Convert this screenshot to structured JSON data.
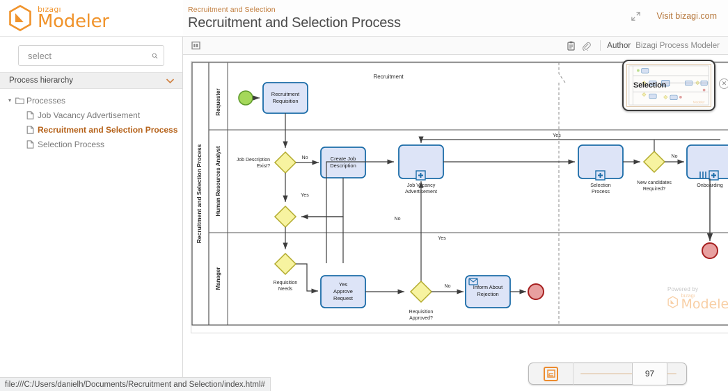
{
  "brand": {
    "small": "bızagı",
    "name": "Modeler",
    "accent": "#f0932b"
  },
  "header": {
    "breadcrumb": "Recruitment and Selection",
    "title": "Recruitment and Selection Process",
    "fullscreen_icon": "fullscreen-icon",
    "visit_link": "Visit bizagi.com"
  },
  "toolbar": {
    "panel_icon": "panel-toggle-icon",
    "doc_icon": "document-icon",
    "attach_icon": "paperclip-icon",
    "author_label": "Author",
    "author_value": "Bizagi Process Modeler"
  },
  "sidebar": {
    "search": {
      "placeholder": "select",
      "value": "",
      "icon": "search-icon"
    },
    "hierarchy_header": {
      "label": "Process hierarchy",
      "chevron": "chevron-down-icon"
    },
    "tree": [
      {
        "label": "Processes",
        "level": 1,
        "icon": "folder-icon",
        "caret": "▾",
        "active": false
      },
      {
        "label": "Job Vacancy Advertisement",
        "level": 2,
        "icon": "file-icon",
        "active": false
      },
      {
        "label": "Recruitment and Selection Process",
        "level": 2,
        "icon": "file-icon",
        "active": true
      },
      {
        "label": "Selection Process",
        "level": 2,
        "icon": "file-icon",
        "active": false
      }
    ]
  },
  "diagram": {
    "pool_label": "Recruitment and Selection Process",
    "phase_label": "Recruitment",
    "lanes": [
      "Requester",
      "Human Resources Analyst",
      "Manager"
    ],
    "nodes": {
      "start_event": "start-event",
      "recruitment_requisition": "Recruitment\nRequisition",
      "recruitment_requisition_l1": "Recruitment",
      "recruitment_requisition_l2": "Requisition",
      "job_desc_gw_l1": "Job Description",
      "job_desc_gw_l2": "Exist?",
      "create_job_desc_l1": "Create Job",
      "create_job_desc_l2": "Description",
      "job_vacancy_l1": "Job Vacancy",
      "job_vacancy_l2": "Advertisement",
      "selection_process_l1": "Selection",
      "selection_process_l2": "Process",
      "new_candidates_l1": "New candidates",
      "new_candidates_l2": "Required?",
      "onboarding": "Onboarding",
      "requisition_needs_l1": "Requisition",
      "requisition_needs_l2": "Needs",
      "approve_request_l1": "Yes",
      "approve_request_l2": "Approve",
      "approve_request_l3": "Request",
      "requisition_approved_l1": "Requisition",
      "requisition_approved_l2": "Approved?",
      "inform_rejection_l1": "Inform About",
      "inform_rejection_l2": "Rejection"
    },
    "flow_labels": {
      "no_1": "No",
      "yes_1": "Yes",
      "no_2": "No",
      "yes_2": "Yes",
      "yes_3": "Yes",
      "no_3": "No",
      "no_4": "No"
    },
    "colors": {
      "task_fill": "#dde4f7",
      "task_stroke": "#1b6ca8",
      "gateway_fill": "#f7f3a0",
      "gateway_stroke": "#b3ab2d",
      "start_fill": "#a5d85a",
      "start_stroke": "#5f9a2c",
      "end_fill": "#e8a0a0",
      "end_stroke": "#a62020",
      "flow": "#4a4a4a"
    }
  },
  "minimap": {
    "label": "Selection",
    "close_icon": "close-icon"
  },
  "zoom_control": {
    "fit_icon": "fit-to-screen-icon",
    "value": "97"
  },
  "powered": {
    "text": "Powered by",
    "small": "bızagı",
    "name": "Modeler"
  },
  "statusbar": {
    "url": "file:///C:/Users/danielh/Documents/Recruitment and Selection/index.html#"
  }
}
